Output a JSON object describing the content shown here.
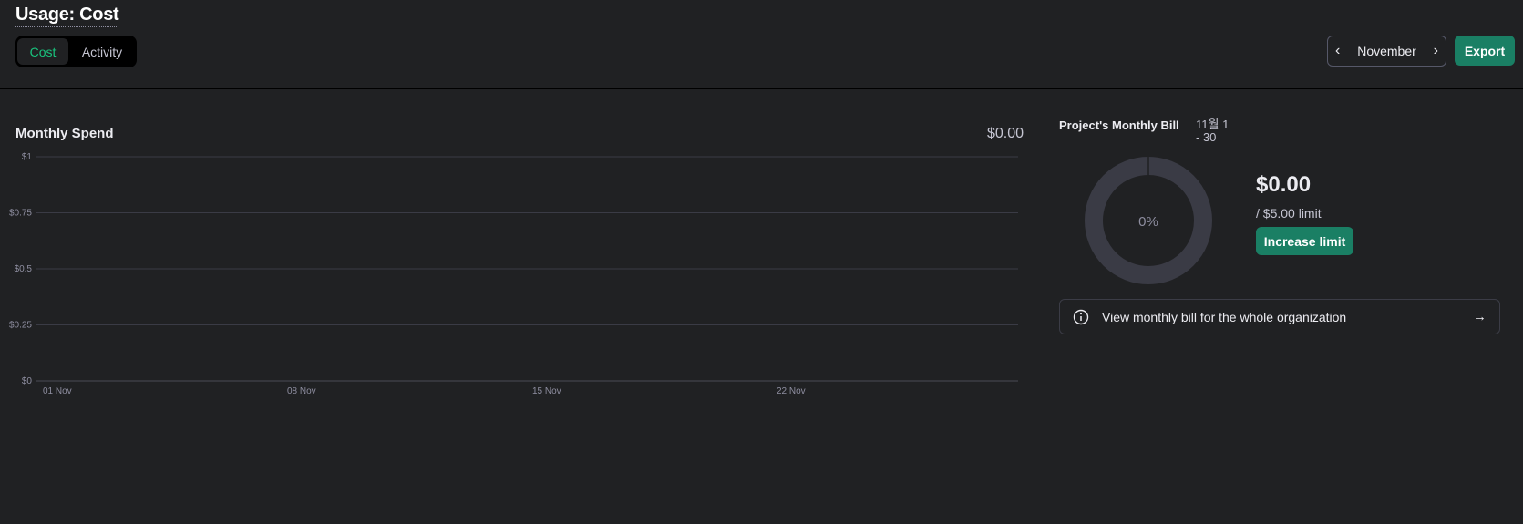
{
  "header": {
    "title": "Usage: Cost",
    "tabs": [
      {
        "label": "Cost",
        "active": true
      },
      {
        "label": "Activity",
        "active": false
      }
    ],
    "month": "November",
    "export_label": "Export"
  },
  "chart_data": {
    "type": "bar",
    "title": "Monthly Spend",
    "total": "$0.00",
    "y_ticks": [
      "$1",
      "$0.75",
      "$0.5",
      "$0.25",
      "$0"
    ],
    "x_ticks": [
      "01 Nov",
      "08 Nov",
      "15 Nov",
      "22 Nov"
    ],
    "ylim": [
      0,
      1
    ],
    "categories": [],
    "values": [],
    "grid": true
  },
  "bill": {
    "title": "Project's Monthly Bill",
    "range": "11월 1 - 30",
    "percent": "0%",
    "percent_value": 0,
    "amount": "$0.00",
    "limit": "/ $5.00 limit",
    "increase_label": "Increase limit",
    "org_link": "View monthly bill for the whole organization"
  },
  "colors": {
    "accent": "#1a7f64",
    "active_tab": "#19c37d",
    "background": "#202123",
    "donut_track": "#3a3b45"
  },
  "icons": {
    "prev": "chevron-left-icon",
    "next": "chevron-right-icon",
    "info": "info-icon",
    "arrow": "arrow-right-icon"
  }
}
